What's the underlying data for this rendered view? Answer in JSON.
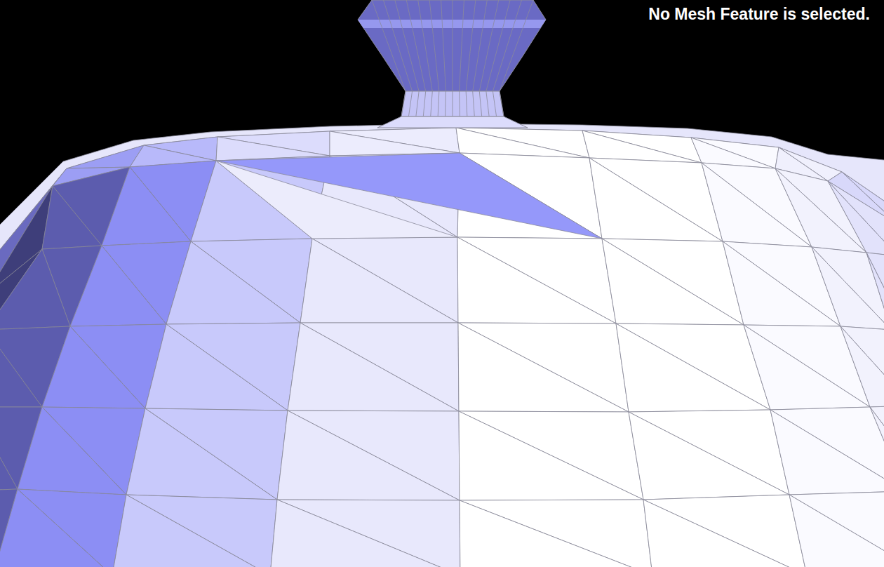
{
  "viewport": {
    "status_message": "No Mesh Feature is selected.",
    "feature_selected": false
  }
}
